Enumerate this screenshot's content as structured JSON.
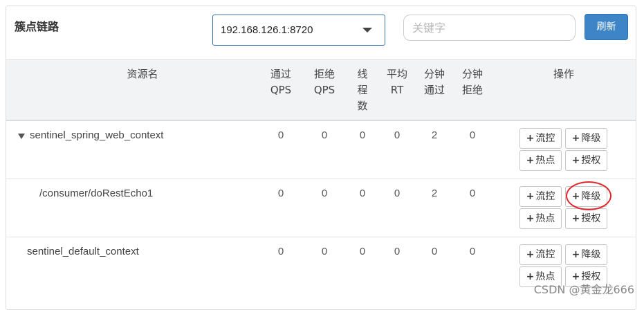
{
  "header": {
    "title": "簇点链路",
    "machine_select": "192.168.126.1:8720",
    "search_placeholder": "关键字",
    "refresh_label": "刷新"
  },
  "table": {
    "columns": {
      "resource": "资源名",
      "pass_qps": [
        "通过",
        "QPS"
      ],
      "block_qps": [
        "拒绝",
        "QPS"
      ],
      "threads": [
        "线",
        "程",
        "数"
      ],
      "avg_rt": [
        "平均",
        "RT"
      ],
      "minute_pass": [
        "分钟",
        "通过"
      ],
      "minute_block": [
        "分钟",
        "拒绝"
      ],
      "actions": "操作"
    },
    "rows": [
      {
        "name": "sentinel_spring_web_context",
        "pass_qps": "0",
        "block_qps": "0",
        "threads": "0",
        "avg_rt": "0",
        "minute_pass": "2",
        "minute_block": "0"
      },
      {
        "name": "/consumer/doRestEcho1",
        "pass_qps": "0",
        "block_qps": "0",
        "threads": "0",
        "avg_rt": "0",
        "minute_pass": "2",
        "minute_block": "0"
      },
      {
        "name": "sentinel_default_context",
        "pass_qps": "0",
        "block_qps": "0",
        "threads": "0",
        "avg_rt": "0",
        "minute_pass": "0",
        "minute_block": "0"
      }
    ],
    "actions": {
      "flow": "流控",
      "degrade": "降级",
      "hotspot": "热点",
      "auth": "授权"
    }
  },
  "icons": {
    "plus": "+",
    "caret": "caret-down-icon",
    "expand": "triangle-down-icon"
  },
  "annotation_color": "#e0262b",
  "watermark": "CSDN @黄金龙666"
}
